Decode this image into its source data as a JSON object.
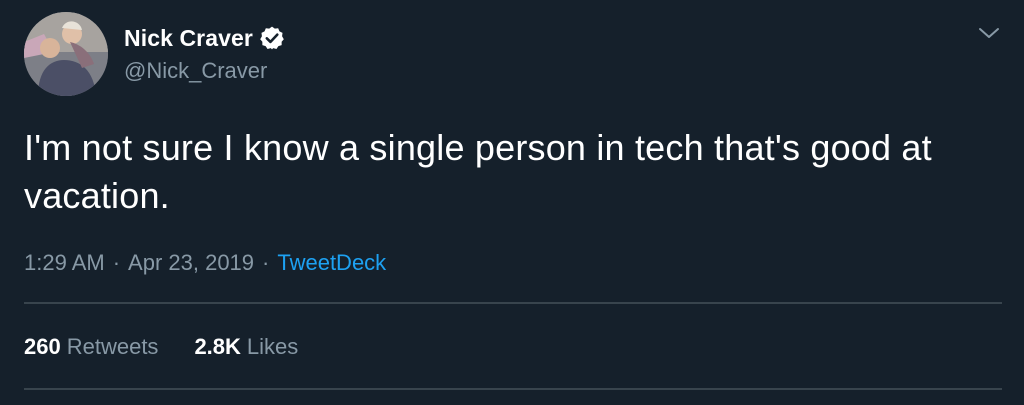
{
  "author": {
    "display_name": "Nick Craver",
    "handle": "@Nick_Craver",
    "verified": true
  },
  "tweet": {
    "text_line1": "I'm not sure I know a single person in tech that's good at",
    "text_line2": "vacation.",
    "time": "1:29 AM",
    "date": "Apr 23, 2019",
    "separator": "·",
    "source": "TweetDeck"
  },
  "stats": {
    "retweets_count": "260",
    "retweets_label": "Retweets",
    "likes_count": "2.8K",
    "likes_label": "Likes"
  },
  "icons": {
    "verified": "verified-badge-icon",
    "menu": "chevron-down-icon"
  },
  "colors": {
    "background": "#15202b",
    "primary_text": "#ffffff",
    "secondary_text": "#8899a6",
    "link": "#1da1f2",
    "divider": "#38444d"
  }
}
